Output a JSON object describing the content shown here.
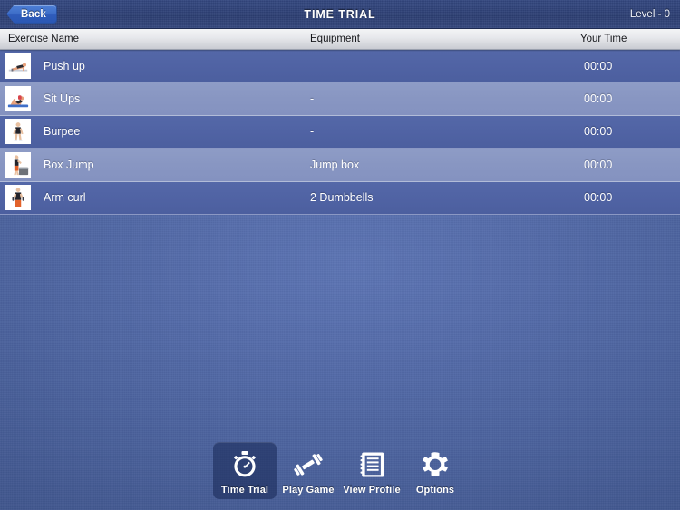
{
  "navbar": {
    "back_label": "Back",
    "title": "TIME TRIAL",
    "level_label": "Level - 0"
  },
  "table": {
    "columns": {
      "name": "Exercise Name",
      "equipment": "Equipment",
      "time": "Your Time"
    },
    "rows": [
      {
        "thumb": "pushup-thumbnail",
        "name": "Push up",
        "equipment": "",
        "time": "00:00"
      },
      {
        "thumb": "situps-thumbnail",
        "name": "Sit Ups",
        "equipment": "-",
        "time": "00:00"
      },
      {
        "thumb": "burpee-thumbnail",
        "name": "Burpee",
        "equipment": "-",
        "time": "00:00"
      },
      {
        "thumb": "boxjump-thumbnail",
        "name": "Box Jump",
        "equipment": "Jump box",
        "time": "00:00"
      },
      {
        "thumb": "armcurl-thumbnail",
        "name": "Arm curl",
        "equipment": "2 Dumbbells",
        "time": "00:00"
      }
    ]
  },
  "tabbar": {
    "selected_index": 0,
    "tabs": [
      {
        "label": "Time Trial",
        "icon": "stopwatch-icon"
      },
      {
        "label": "Play Game",
        "icon": "dumbbell-icon"
      },
      {
        "label": "View Profile",
        "icon": "notebook-icon"
      },
      {
        "label": "Options",
        "icon": "gear-icon"
      }
    ]
  },
  "colors": {
    "navbar": "#2f4278",
    "row_dark": "#5063a4",
    "row_light": "#8896c2",
    "accent_button": "#3f6fc9",
    "background": "#4d649f"
  }
}
